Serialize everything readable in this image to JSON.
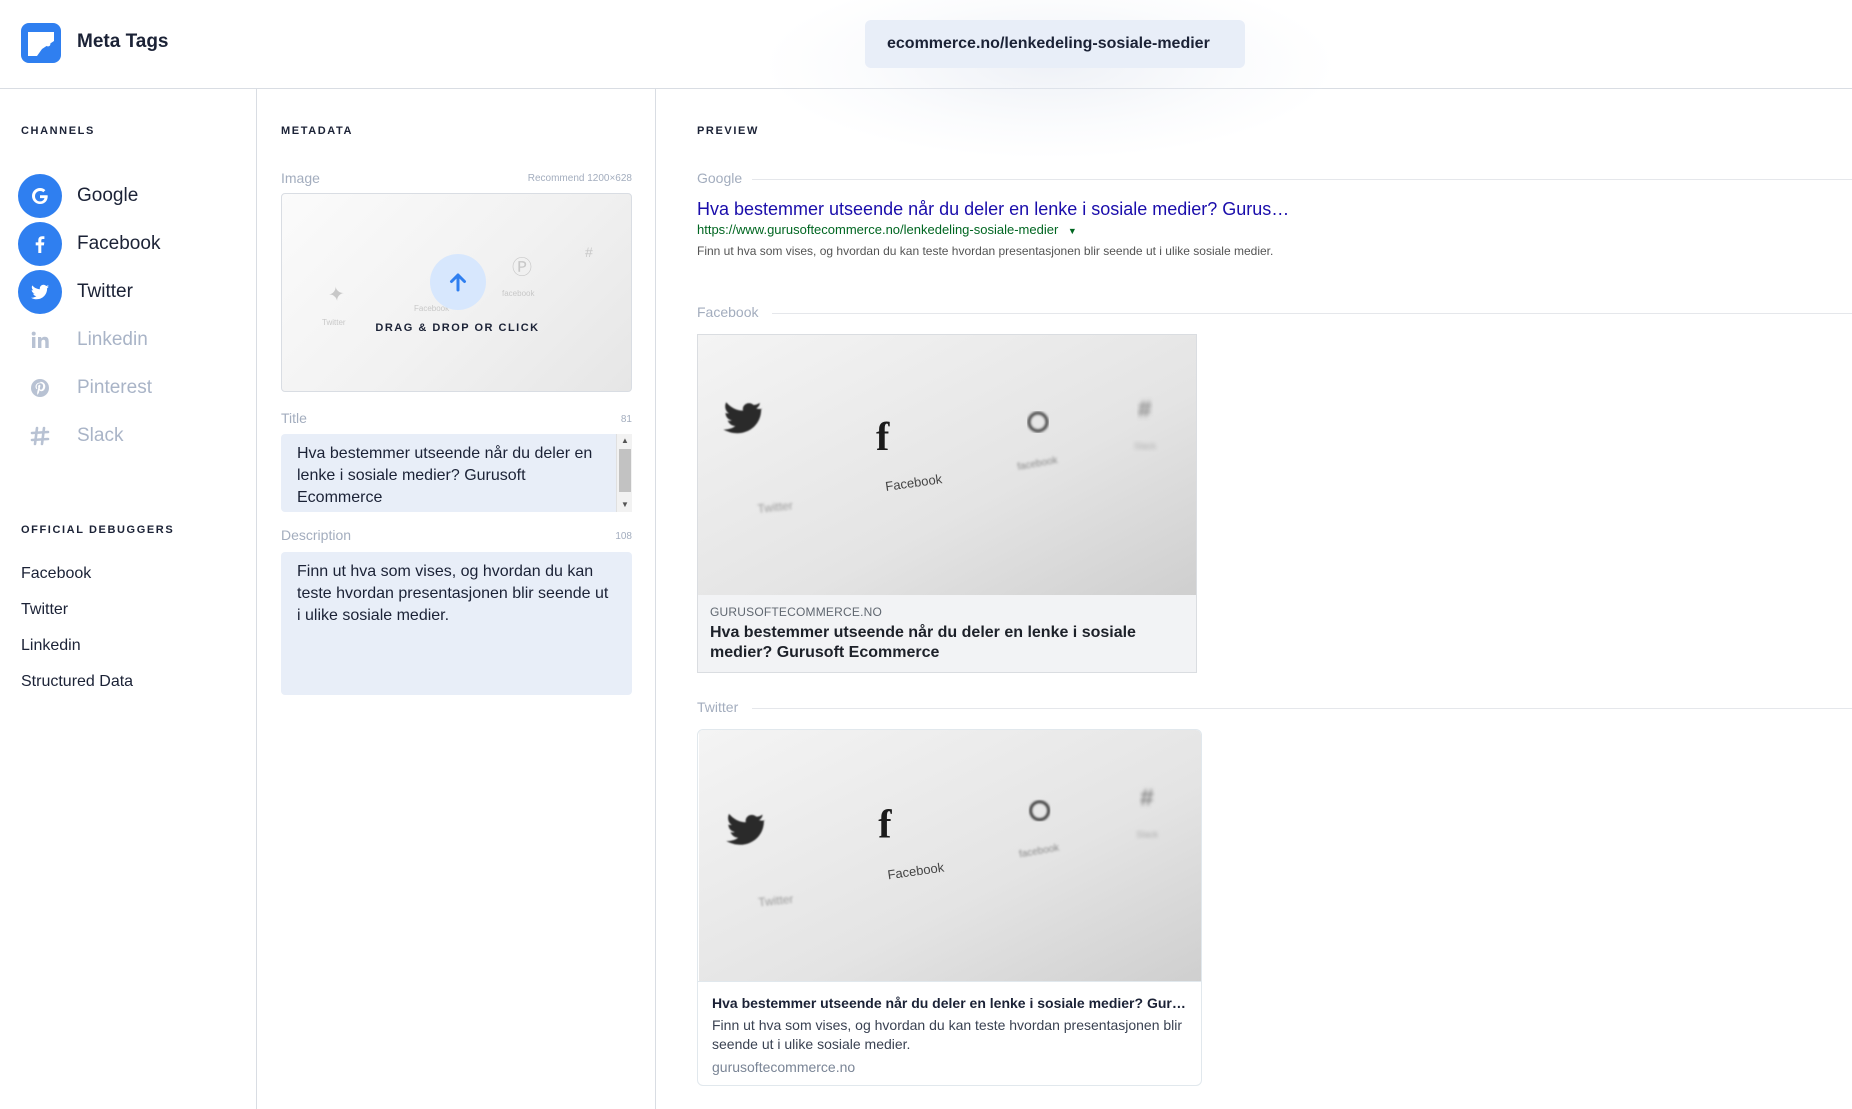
{
  "header": {
    "app_title": "Meta Tags",
    "url_value": "ecommerce.no/lenkedeling-sosiale-medier",
    "accent_color": "#2f7ff0"
  },
  "channels": {
    "heading": "Channels",
    "items": [
      {
        "label": "Google",
        "icon": "google-icon",
        "active": true
      },
      {
        "label": "Facebook",
        "icon": "facebook-icon",
        "active": true
      },
      {
        "label": "Twitter",
        "icon": "twitter-icon",
        "active": true
      },
      {
        "label": "Linkedin",
        "icon": "linkedin-icon",
        "active": false
      },
      {
        "label": "Pinterest",
        "icon": "pinterest-icon",
        "active": false
      },
      {
        "label": "Slack",
        "icon": "slack-icon",
        "active": false
      }
    ]
  },
  "debuggers": {
    "heading": "Official Debuggers",
    "items": [
      "Facebook",
      "Twitter",
      "Linkedin",
      "Structured Data"
    ]
  },
  "metadata": {
    "heading": "Metadata",
    "image_label": "Image",
    "image_hint": "Recommend 1200×628",
    "drop_text": "DRAG & DROP OR CLICK",
    "title_label": "Title",
    "title_count": "81",
    "title_value": "Hva bestemmer utseende når du deler en lenke i sosiale medier? Gurusoft Ecommerce",
    "description_label": "Description",
    "description_count": "108",
    "description_value": "Finn ut hva som vises, og hvordan du kan teste hvordan presentasjonen blir seende ut i ulike sosiale medier."
  },
  "preview": {
    "heading": "Preview",
    "google": {
      "label": "Google",
      "title": "Hva bestemmer utseende når du deler en lenke i sosiale medier? Gurus…",
      "url": "https://www.gurusoftecommerce.no/lenkedeling-sosiale-medier",
      "description": "Finn ut hva som vises, og hvordan du kan teste hvordan presentasjonen blir seende ut i ulike sosiale medier."
    },
    "facebook": {
      "label": "Facebook",
      "domain": "GURUSOFTECOMMERCE.NO",
      "title": "Hva bestemmer utseende når du deler en lenke i sosiale medier? Gurusoft Ecommerce"
    },
    "twitter": {
      "label": "Twitter",
      "title": "Hva bestemmer utseende når du deler en lenke i sosiale medier? Gur…",
      "description": "Finn ut hva som vises, og hvordan du kan teste hvordan presentasjonen blir seende ut i ulike sosiale medier.",
      "domain": "gurusoftecommerce.no"
    },
    "image_labels": {
      "twitter": "Twitter",
      "facebook": "Facebook",
      "facebook_small": "facebook",
      "slack": "Slack"
    }
  }
}
